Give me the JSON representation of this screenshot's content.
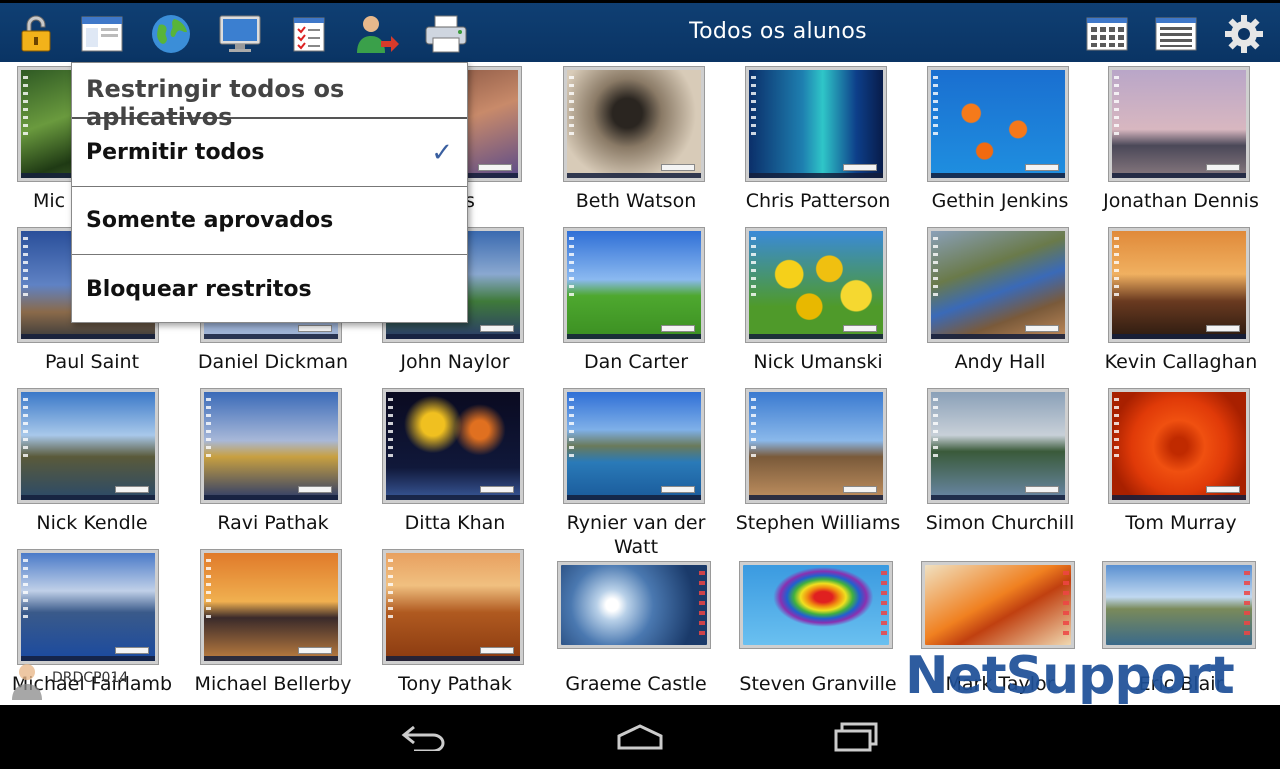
{
  "header": {
    "title": "Todos os alunos",
    "icons": [
      "lock-icon",
      "window-icon",
      "globe-icon",
      "monitor-icon",
      "checklist-icon",
      "user-remove-icon",
      "printer-icon",
      "grid-view-icon",
      "list-view-icon",
      "settings-icon"
    ]
  },
  "menu": {
    "title": "Restringir todos os aplicativos",
    "items": [
      {
        "label": "Permitir todos",
        "checked": true
      },
      {
        "label": "Somente aprovados",
        "checked": false
      },
      {
        "label": "Bloquear restritos",
        "checked": false
      }
    ]
  },
  "students": [
    [
      "Mic",
      "Jones",
      "Beth Watson",
      "Chris Patterson",
      "Gethin Jenkins",
      "Jonathan Dennis"
    ],
    [
      "Paul Saint",
      "Daniel Dickman",
      "John Naylor",
      "Dan Carter",
      "Nick Umanski",
      "Andy Hall",
      "Kevin Callaghan"
    ],
    [
      "Nick Kendle",
      "Ravi Pathak",
      "Ditta Khan",
      "Rynier van der Watt",
      "Stephen Williams",
      "Simon Churchill",
      "Tom Murray"
    ],
    [
      "Michael Fairlamb",
      "Michael Bellerby",
      "Tony Pathak",
      "Graeme Castle",
      "Steven Granville",
      "Mark Taylor",
      "Eric Blair"
    ]
  ],
  "device_label": "DRDCP014",
  "logo_text": "NetSupport",
  "colors": {
    "topbar": "#0a3464",
    "accent_check": "#3a5fa0"
  }
}
